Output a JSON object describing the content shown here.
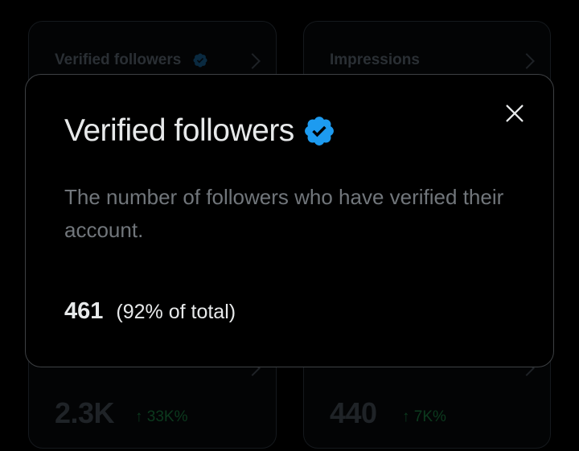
{
  "background_cards": {
    "top_left": {
      "title": "Verified followers"
    },
    "top_right": {
      "title": "Impressions"
    },
    "bottom_left": {
      "value": "2.3K",
      "change": "↑ 33K%"
    },
    "bottom_right": {
      "value": "440",
      "change": "↑ 7K%"
    }
  },
  "modal": {
    "title": "Verified followers",
    "description": "The number of followers who have verified their account.",
    "stat_value": "461",
    "stat_percent": "(92% of total)",
    "close_icon": "close-icon",
    "badge_icon": "verified-badge-icon"
  },
  "colors": {
    "background": "#000000",
    "title_text": "#e7e9ea",
    "secondary_text": "#71767b",
    "verified_blue": "#1d9bf0",
    "modal_border": "#3e4144"
  }
}
